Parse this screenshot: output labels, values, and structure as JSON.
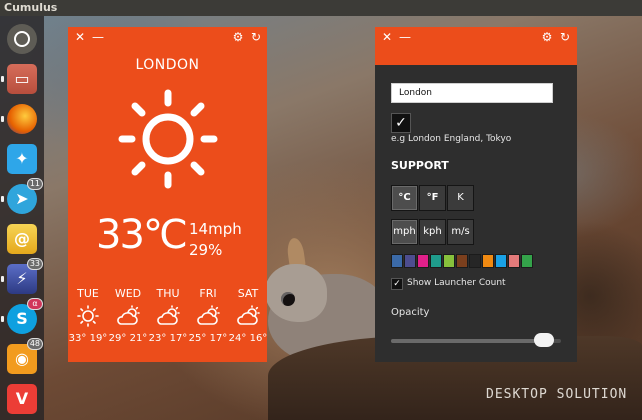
{
  "top_panel": {
    "title": "Cumulus"
  },
  "launcher": {
    "items": [
      {
        "name": "ubuntu",
        "badge": ""
      },
      {
        "name": "files",
        "badge": ""
      },
      {
        "name": "firefox",
        "badge": ""
      },
      {
        "name": "twitter",
        "badge": ""
      },
      {
        "name": "telegram",
        "badge": "11"
      },
      {
        "name": "mail",
        "badge": ""
      },
      {
        "name": "lightning",
        "badge": "33"
      },
      {
        "name": "skype",
        "badge": ""
      },
      {
        "name": "rss",
        "badge": "48"
      },
      {
        "name": "vivaldi",
        "badge": ""
      }
    ]
  },
  "weather": {
    "close_glyph": "✕",
    "minimize_glyph": "—",
    "settings_glyph": "⚙",
    "refresh_glyph": "↻",
    "city": "LONDON",
    "condition_icon": "sun-icon",
    "temperature": "33℃",
    "wind": "14mph",
    "humidity": "29%",
    "forecast": [
      {
        "day": "TUE",
        "icon": "sun-icon",
        "range": "33° 19°"
      },
      {
        "day": "WED",
        "icon": "partly-cloudy-icon",
        "range": "29° 21°"
      },
      {
        "day": "THU",
        "icon": "partly-cloudy-icon",
        "range": "23° 17°"
      },
      {
        "day": "FRI",
        "icon": "partly-cloudy-icon",
        "range": "25° 17°"
      },
      {
        "day": "SAT",
        "icon": "partly-cloudy-icon",
        "range": "24° 16°"
      }
    ]
  },
  "settings": {
    "location_value": "London",
    "checkbox_glyph": "✓",
    "hint": "e.g London England, Tokyo",
    "support_label": "SUPPORT",
    "temp_units": [
      "°C",
      "°F",
      "K"
    ],
    "temp_selected": 0,
    "speed_units": [
      "mph",
      "kph",
      "m/s"
    ],
    "speed_selected": 0,
    "swatches": [
      "#3b6aa8",
      "#4d4d8f",
      "#e0208a",
      "#1f9c8c",
      "#87c13c",
      "#7b3f1d",
      "#262626",
      "#f08a12",
      "#1aa1e6",
      "#e37a7a",
      "#34a34a"
    ],
    "launcher_count_label": "Show Launcher Count",
    "launcher_count_checked": true,
    "opacity_label": "Opacity",
    "opacity_value": 0.95
  },
  "watermark": "DESKTOP SOLUTION",
  "colors": {
    "accent": "#ec4d1b",
    "panel": "#2e2e2e"
  }
}
